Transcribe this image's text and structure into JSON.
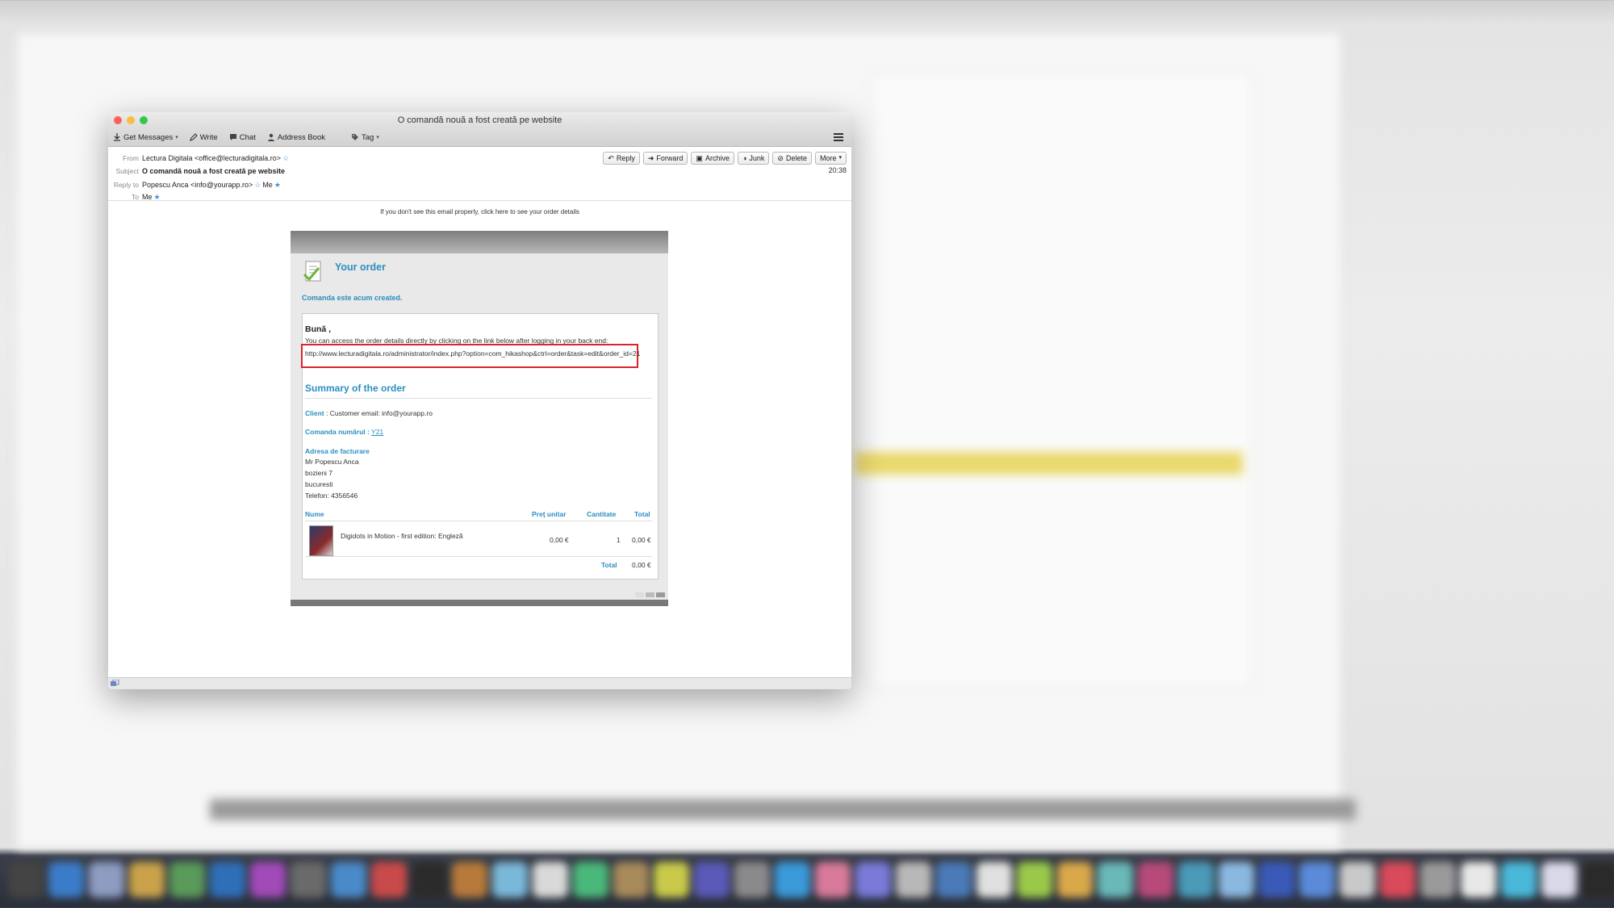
{
  "window": {
    "title": "O comandă nouă a fost creată pe website"
  },
  "toolbar": {
    "get_messages": "Get Messages",
    "write": "Write",
    "chat": "Chat",
    "address_book": "Address Book",
    "tag": "Tag"
  },
  "header": {
    "from_label": "From",
    "from_value": "Lectura Digitala <office@lecturadigitala.ro>",
    "subject_label": "Subject",
    "subject_value": "O comandă nouă a fost creată pe website",
    "reply_to_label": "Reply to",
    "reply_to_value": "Popescu Anca <info@yourapp.ro>",
    "reply_to_me": "Me",
    "to_label": "To",
    "to_value": "Me",
    "time": "20:38",
    "actions": {
      "reply": "Reply",
      "forward": "Forward",
      "archive": "Archive",
      "junk": "Junk",
      "delete": "Delete",
      "more": "More"
    }
  },
  "email": {
    "notice": "If you don't see this email properly, click here to see your order details",
    "order_title": "Your order",
    "status": "Comanda este acum created.",
    "greeting": "Bună ,",
    "intro": "You can access the order details directly by clicking on the link below after logging in your back end:",
    "link": "http://www.lecturadigitala.ro/administrator/index.php?option=com_hikashop&ctrl=order&task=edit&order_id=21",
    "summary_title": "Summary of the order",
    "client_label": "Client",
    "client_value": ": Customer email: info@yourapp.ro",
    "order_number_label": "Comanda numărul :",
    "order_number": "Y21",
    "billing_label": "Adresa de facturare",
    "billing_lines": [
      "Mr Popescu Anca",
      "bozieni 7",
      "bucuresti",
      "Telefon: 4356546"
    ],
    "columns": {
      "name": "Nume",
      "unit_price": "Preț unitar",
      "quantity": "Cantitate",
      "total": "Total"
    },
    "item": {
      "name": "Digidots in Motion - first edition: Engleză",
      "unit_price": "0,00 €",
      "quantity": "1",
      "total": "0,00 €"
    },
    "total_label": "Total",
    "total_value": "0,00 €"
  },
  "colors": {
    "accent": "#2a8ebf",
    "highlight_box": "#d9252b",
    "close": "#fc605b",
    "minimize": "#fdbc40",
    "maximize": "#34c84a"
  }
}
